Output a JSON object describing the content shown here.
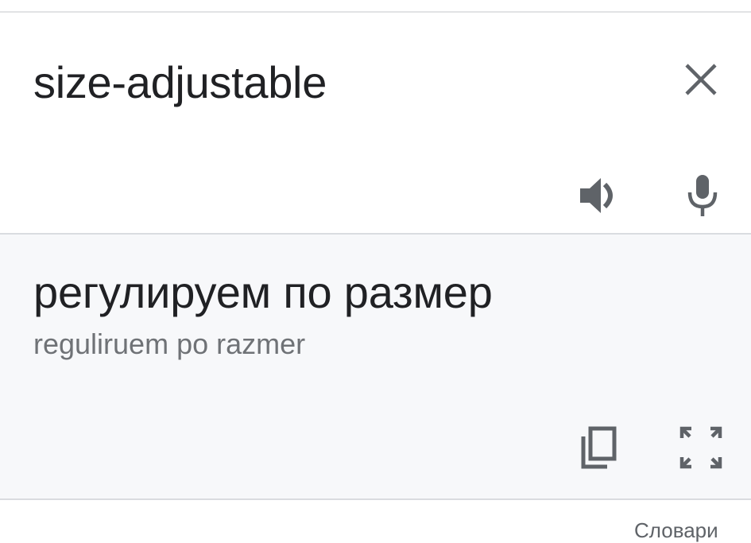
{
  "source": {
    "text": "size-adjustable",
    "icons": {
      "clear": "close-icon",
      "listen": "speaker-icon",
      "voice_input": "microphone-icon"
    }
  },
  "result": {
    "translation": "регулируем по размер",
    "transliteration": "reguliruem po razmer",
    "icons": {
      "copy": "copy-icon",
      "fullscreen": "fullscreen-icon"
    }
  },
  "footer": {
    "link_label": "Словари"
  },
  "colors": {
    "text_primary": "#202124",
    "text_secondary": "#6f7276",
    "icon": "#5f6368",
    "result_background": "#f7f8fa",
    "divider": "#dadce0"
  }
}
